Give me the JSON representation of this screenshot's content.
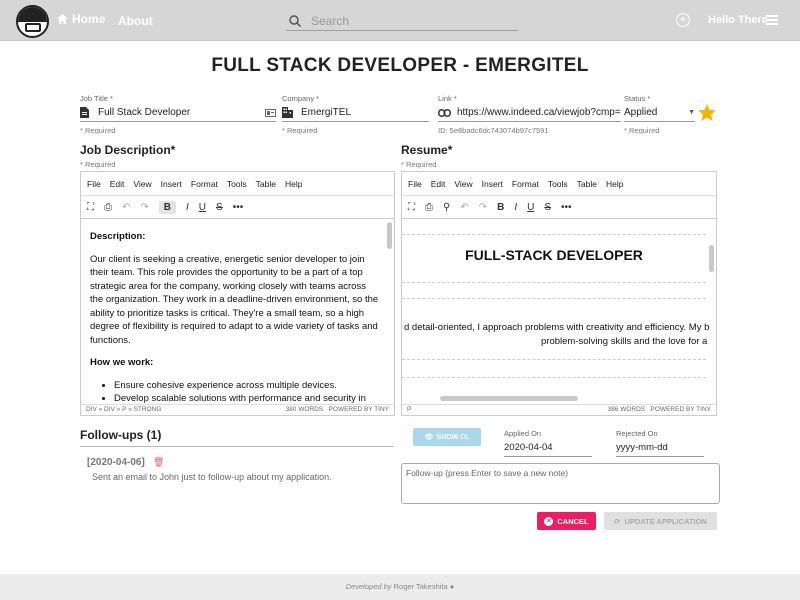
{
  "header": {
    "home_label": "Home",
    "about_label": "About",
    "search_placeholder": "Search",
    "user_name": "Hello There"
  },
  "page_title": "FULL STACK DEVELOPER - EMERGITEL",
  "fields": {
    "job_title": {
      "label": "Job Title *",
      "value": "Full Stack Developer",
      "required": "* Required"
    },
    "company": {
      "label": "Company *",
      "value": "EmergiTEL",
      "required": "* Required"
    },
    "link": {
      "label": "Link *",
      "value": "https://www.indeed.ca/viewjob?cmp=",
      "id_text": "ID: 5e8badc6dc743074b97c7591"
    },
    "status": {
      "label": "Status *",
      "value": "Applied",
      "required": "* Required"
    }
  },
  "job_description": {
    "title": "Job Description*",
    "required": "* Required",
    "menu": [
      "File",
      "Edit",
      "View",
      "Insert",
      "Format",
      "Tools",
      "Table",
      "Help"
    ],
    "heading1": "Description:",
    "paragraph": "Our client is seeking a creative, energetic senior developer to join their team. This role provides the opportunity to be a part of a top strategic area for the company, working closely with teams across the organization. They work in a deadline-driven environment, so the ability to prioritize tasks is critical. They're a small team, so a high degree of flexibility is required to adapt to a wide variety of tasks and functions.",
    "heading2": "How we work:",
    "bullets": [
      "Ensure cohesive experience across multiple devices.",
      "Develop scalable solutions with performance and security in"
    ],
    "path": "DIV » DIV » P » STRONG",
    "words": "380 WORDS",
    "powered": "POWERED BY TINY"
  },
  "resume": {
    "title": "Resume*",
    "required": "* Required",
    "menu": [
      "File",
      "Edit",
      "View",
      "Insert",
      "Format",
      "Tools",
      "Table",
      "Help"
    ],
    "heading": "FULL-STACK DEVELOPER",
    "line1": "d detail-oriented, I approach problems with creativity and efficiency. My b",
    "line2": "problem-solving skills and the love for a",
    "path": "P",
    "words": "386 WORDS",
    "powered": "POWERED BY TINY"
  },
  "followups": {
    "title": "Follow-ups (1)",
    "items": [
      {
        "date": "[2020-04-06]",
        "text": "Sent an email to John just to follow-up about my application."
      }
    ],
    "note_placeholder": "Follow-up (press Enter to save a new note)"
  },
  "actions": {
    "show_cl": "SHOW CL",
    "applied_on_label": "Applied On",
    "applied_on_value": "2020-04-04",
    "rejected_on_label": "Rejected On",
    "rejected_on_value": "yyyy-mm-dd",
    "cancel": "CANCEL",
    "update": "UPDATE APPLICATION"
  },
  "footer": {
    "developed_by": "Developed by",
    "author": "Roger Takeshita"
  },
  "colors": {
    "accent_pink": "#e91e63",
    "star": "#f5b301",
    "showcl": "#a8d8ea"
  }
}
